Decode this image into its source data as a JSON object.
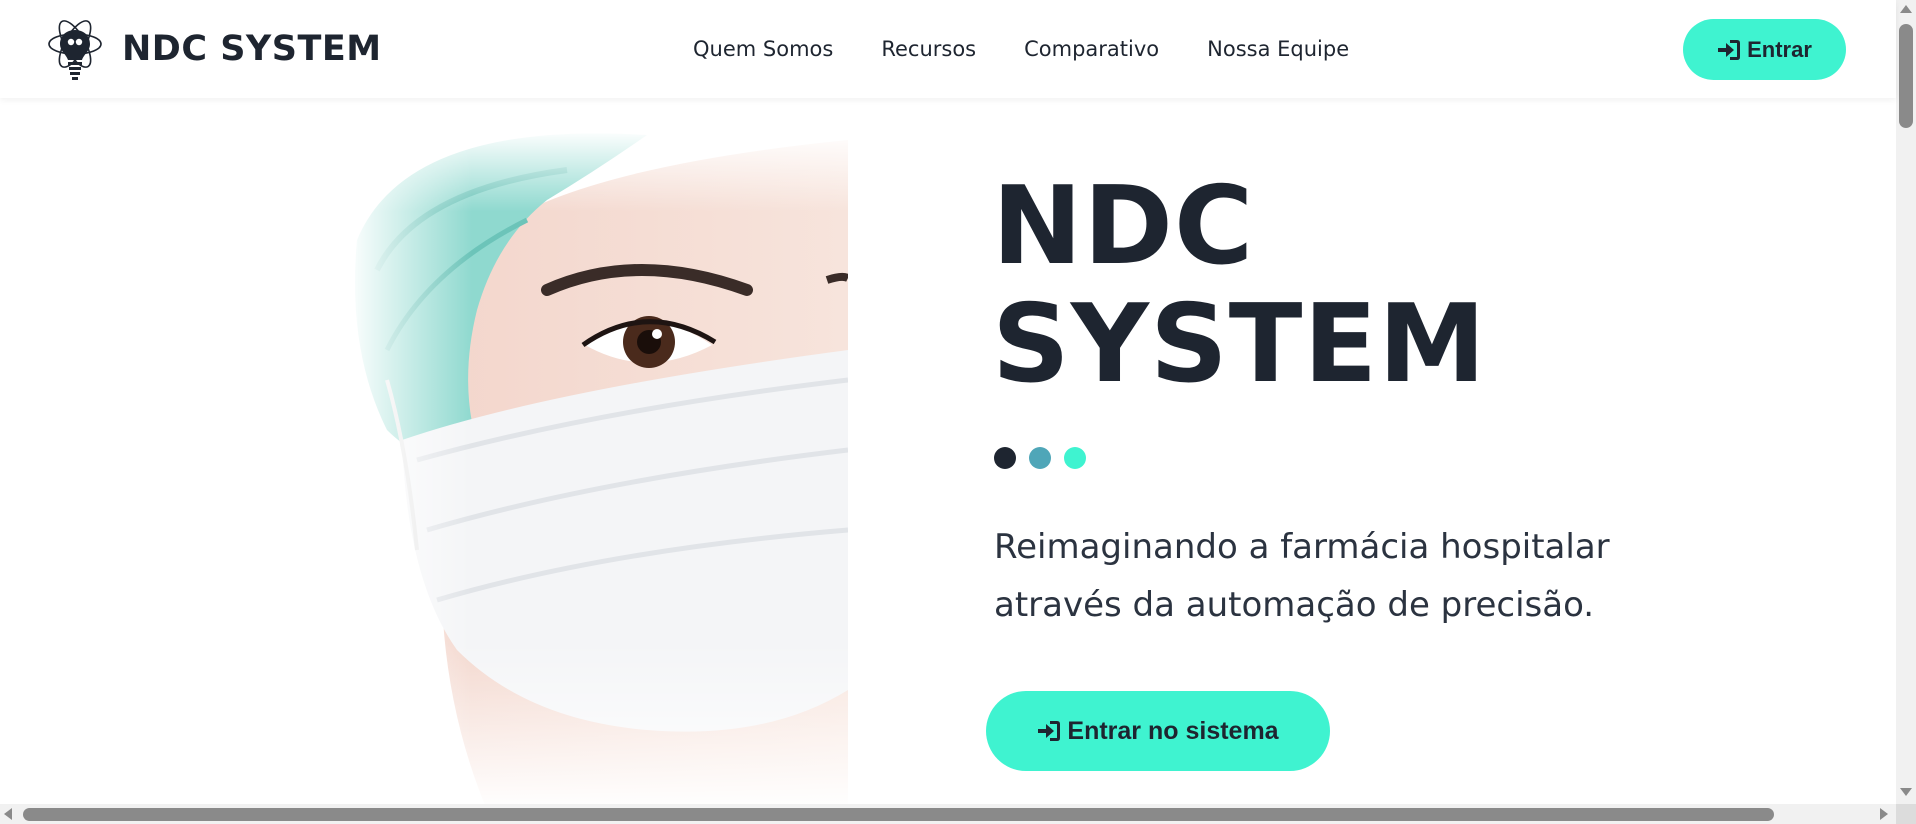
{
  "header": {
    "brand_name": "NDC SYSTEM",
    "logo_icon": "lightbulb-atom-logo",
    "nav": [
      {
        "label": "Quem Somos"
      },
      {
        "label": "Recursos"
      },
      {
        "label": "Comparativo"
      },
      {
        "label": "Nossa Equipe"
      }
    ],
    "login_button": {
      "label": "Entrar",
      "icon": "sign-in-icon"
    }
  },
  "hero": {
    "title_line1": "NDC",
    "title_line2": "SYSTEM",
    "dots": [
      "#1e2530",
      "#4fa6b8",
      "#3ff3d0"
    ],
    "subtitle": "Reimaginando a farmácia hospitalar através da automação de precisão.",
    "cta_button": {
      "label": "Entrar no sistema",
      "icon": "sign-in-icon"
    },
    "image": "healthcare-worker-mask-photo"
  },
  "colors": {
    "accent": "#3ff3d0",
    "text_dark": "#1e2530",
    "teal": "#4fa6b8"
  }
}
